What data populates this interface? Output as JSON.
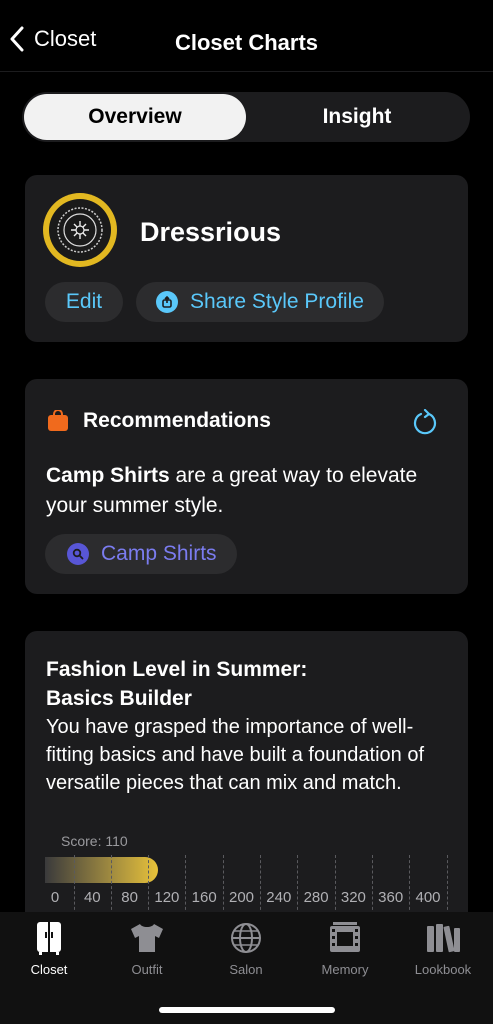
{
  "nav": {
    "back_label": "Closet",
    "title": "Closet Charts"
  },
  "segments": {
    "overview": "Overview",
    "insight": "Insight",
    "active": "overview"
  },
  "profile": {
    "name": "Dressrious",
    "edit_label": "Edit",
    "share_label": "Share Style Profile",
    "avatar_ring_color": "#e2b821"
  },
  "recommendations": {
    "title": "Recommendations",
    "highlight": "Camp Shirts",
    "body": " are a great way to elevate your summer style.",
    "chip_label": "Camp Shirts"
  },
  "fashion_level": {
    "title_line1": "Fashion Level in Summer:",
    "title_line2": "Basics Builder",
    "description": "You have grasped the importance of well-fitting basics and have built a foundation of versatile pieces that can mix and match.",
    "score_text": "Score: 110",
    "score": 110,
    "scale_min": 0,
    "scale_max": 420,
    "ticks": [
      "0",
      "40",
      "80",
      "120",
      "160",
      "200",
      "240",
      "280",
      "320",
      "360",
      "400"
    ]
  },
  "tabbar": {
    "items": [
      {
        "label": "Closet",
        "icon": "wardrobe-icon",
        "active": true
      },
      {
        "label": "Outfit",
        "icon": "tshirt-icon",
        "active": false
      },
      {
        "label": "Salon",
        "icon": "globe-icon",
        "active": false
      },
      {
        "label": "Memory",
        "icon": "film-icon",
        "active": false
      },
      {
        "label": "Lookbook",
        "icon": "books-icon",
        "active": false
      }
    ]
  },
  "colors": {
    "accent_blue": "#5ac8fa",
    "accent_purple": "#7b7cf0",
    "accent_orange": "#f06a1d",
    "gauge_gold": "#e8c23a"
  }
}
